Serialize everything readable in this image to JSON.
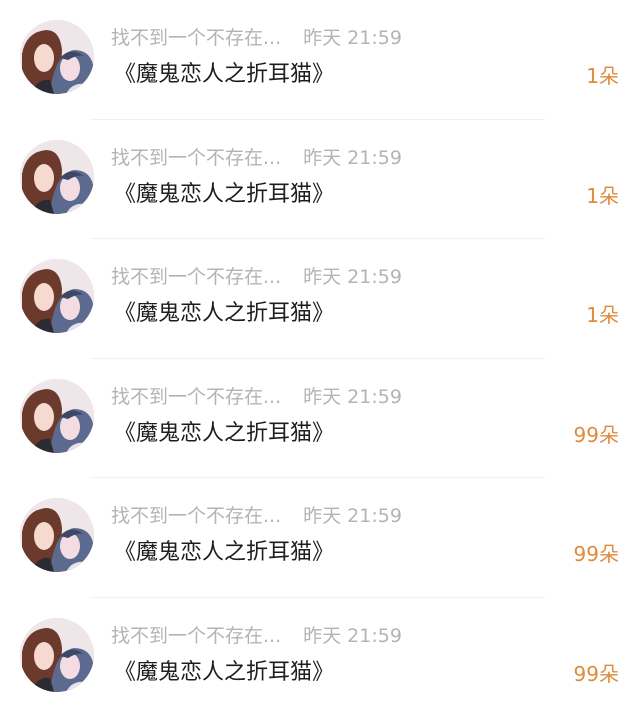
{
  "items": [
    {
      "user": "找不到一个不存在...",
      "time": "昨天 21:59",
      "title": "《魔鬼恋人之折耳猫》",
      "count": "1朵",
      "avatar_icon": "anime-couple-avatar"
    },
    {
      "user": "找不到一个不存在...",
      "time": "昨天 21:59",
      "title": "《魔鬼恋人之折耳猫》",
      "count": "1朵",
      "avatar_icon": "anime-couple-avatar"
    },
    {
      "user": "找不到一个不存在...",
      "time": "昨天 21:59",
      "title": "《魔鬼恋人之折耳猫》",
      "count": "1朵",
      "avatar_icon": "anime-couple-avatar"
    },
    {
      "user": "找不到一个不存在...",
      "time": "昨天 21:59",
      "title": "《魔鬼恋人之折耳猫》",
      "count": "99朵",
      "avatar_icon": "anime-couple-avatar"
    },
    {
      "user": "找不到一个不存在...",
      "time": "昨天 21:59",
      "title": "《魔鬼恋人之折耳猫》",
      "count": "99朵",
      "avatar_icon": "anime-couple-avatar"
    },
    {
      "user": "找不到一个不存在...",
      "time": "昨天 21:59",
      "title": "《魔鬼恋人之折耳猫》",
      "count": "99朵",
      "avatar_icon": "anime-couple-avatar"
    }
  ],
  "colors": {
    "meta_text": "#b4b4b4",
    "title_text": "#1e1e1e",
    "count_accent": "#e08a3c",
    "divider": "#f1f1f1"
  }
}
